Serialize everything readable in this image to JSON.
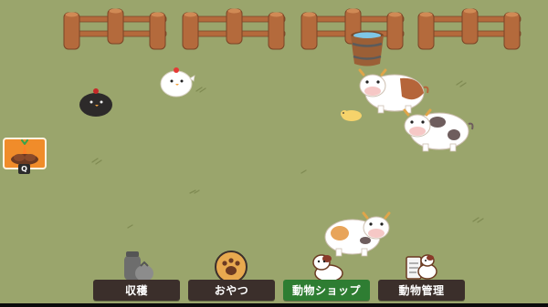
{
  "game": {
    "hotkey_label": "Q",
    "tool_icon": "carrot-seed-pile-icon"
  },
  "toolbar": {
    "buttons": [
      {
        "label": "収穫",
        "icon": "sack-icon",
        "active": false
      },
      {
        "label": "おやつ",
        "icon": "paw-cookie-icon",
        "active": false
      },
      {
        "label": "動物ショップ",
        "icon": "cow-shop-icon",
        "active": true
      },
      {
        "label": "動物管理",
        "icon": "cow-clipboard-icon",
        "active": false
      }
    ]
  },
  "colors": {
    "grass": "#9aa56c",
    "fence": "#b46a3c",
    "button_bg": "#3b2f2b",
    "button_active": "#2e7d32",
    "tool_slot": "#f08c2a"
  }
}
